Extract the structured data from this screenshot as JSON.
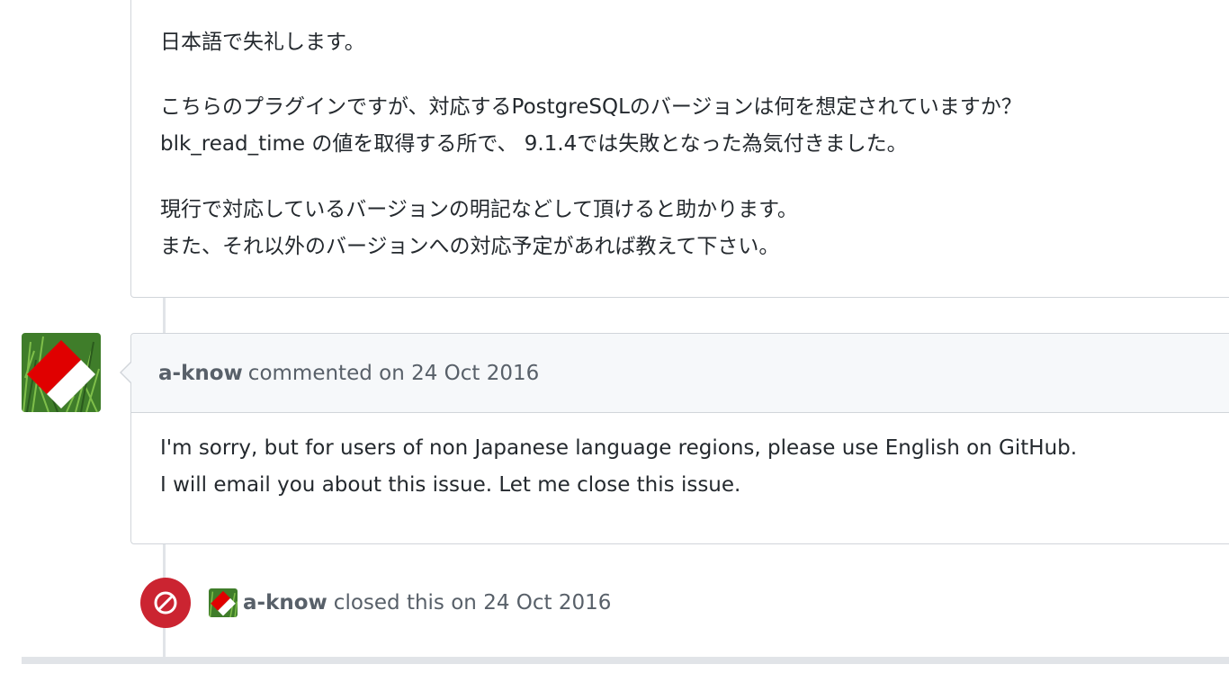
{
  "first_comment": {
    "paragraphs": [
      [
        "日本語で失礼します。"
      ],
      [
        "こちらのプラグインですが、対応するPostgreSQLのバージョンは何を想定されていますか？",
        "blk_read_time の値を取得する所で、 9.1.4では失敗となった為気付きました。"
      ],
      [
        "現行で対応しているバージョンの明記などして頂けると助かります。",
        "また、それ以外のバージョンへの対応予定があれば教えて下さい。"
      ]
    ]
  },
  "second_comment": {
    "author": "a-know",
    "action": "commented on 24 Oct 2016",
    "lines": [
      "I'm sorry, but for users of non Japanese language regions, please use English on GitHub.",
      "I will email you about this issue. Let me close this issue."
    ]
  },
  "close_event": {
    "author": "a-know",
    "action": "closed this on 24 Oct 2016",
    "icon": "circle-slash-icon",
    "color": "#cb2431"
  },
  "avatar": {
    "icon": "avatar-red-white-grass"
  }
}
